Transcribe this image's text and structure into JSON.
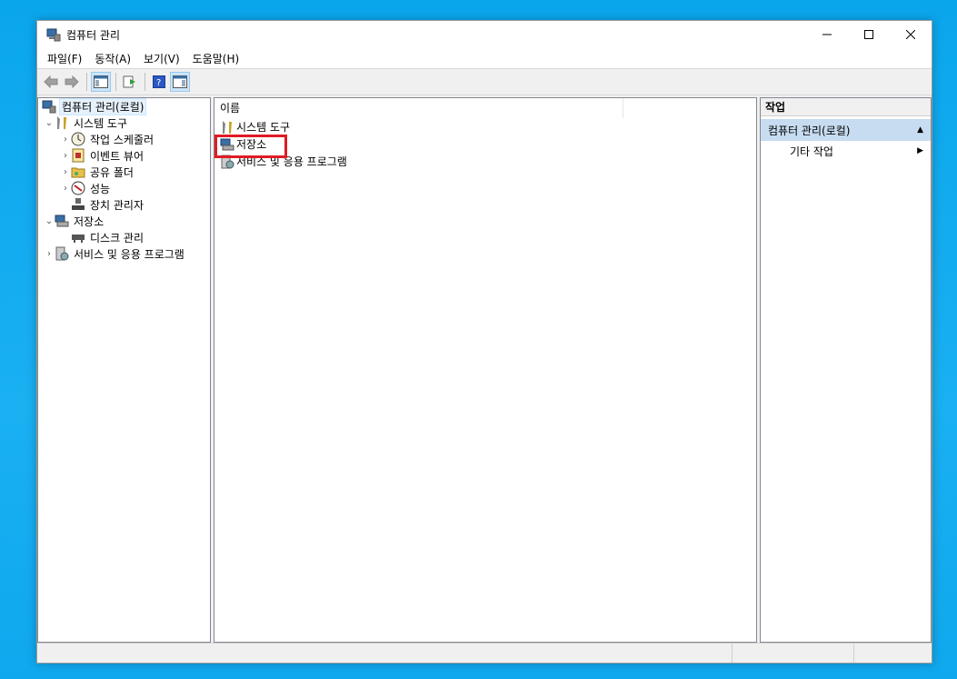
{
  "window": {
    "title": "컴퓨터 관리"
  },
  "menu": [
    "파일(F)",
    "동작(A)",
    "보기(V)",
    "도움말(H)"
  ],
  "tree": {
    "root": "컴퓨터 관리(로컬)",
    "system_tools": "시스템 도구",
    "task_scheduler": "작업 스케줄러",
    "event_viewer": "이벤트 뷰어",
    "shared_folders": "공유 폴더",
    "performance": "성능",
    "device_manager": "장치 관리자",
    "storage": "저장소",
    "disk_management": "디스크 관리",
    "services_apps": "서비스 및 응용 프로그램"
  },
  "list": {
    "column_name": "이름",
    "items": [
      "시스템 도구",
      "저장소",
      "서비스 및 응용 프로그램"
    ]
  },
  "actions": {
    "header": "작업",
    "section": "컴퓨터 관리(로컬)",
    "item": "기타 작업"
  },
  "colors": {
    "highlight": "#e01b24",
    "section_bg": "#c7dcf0"
  }
}
